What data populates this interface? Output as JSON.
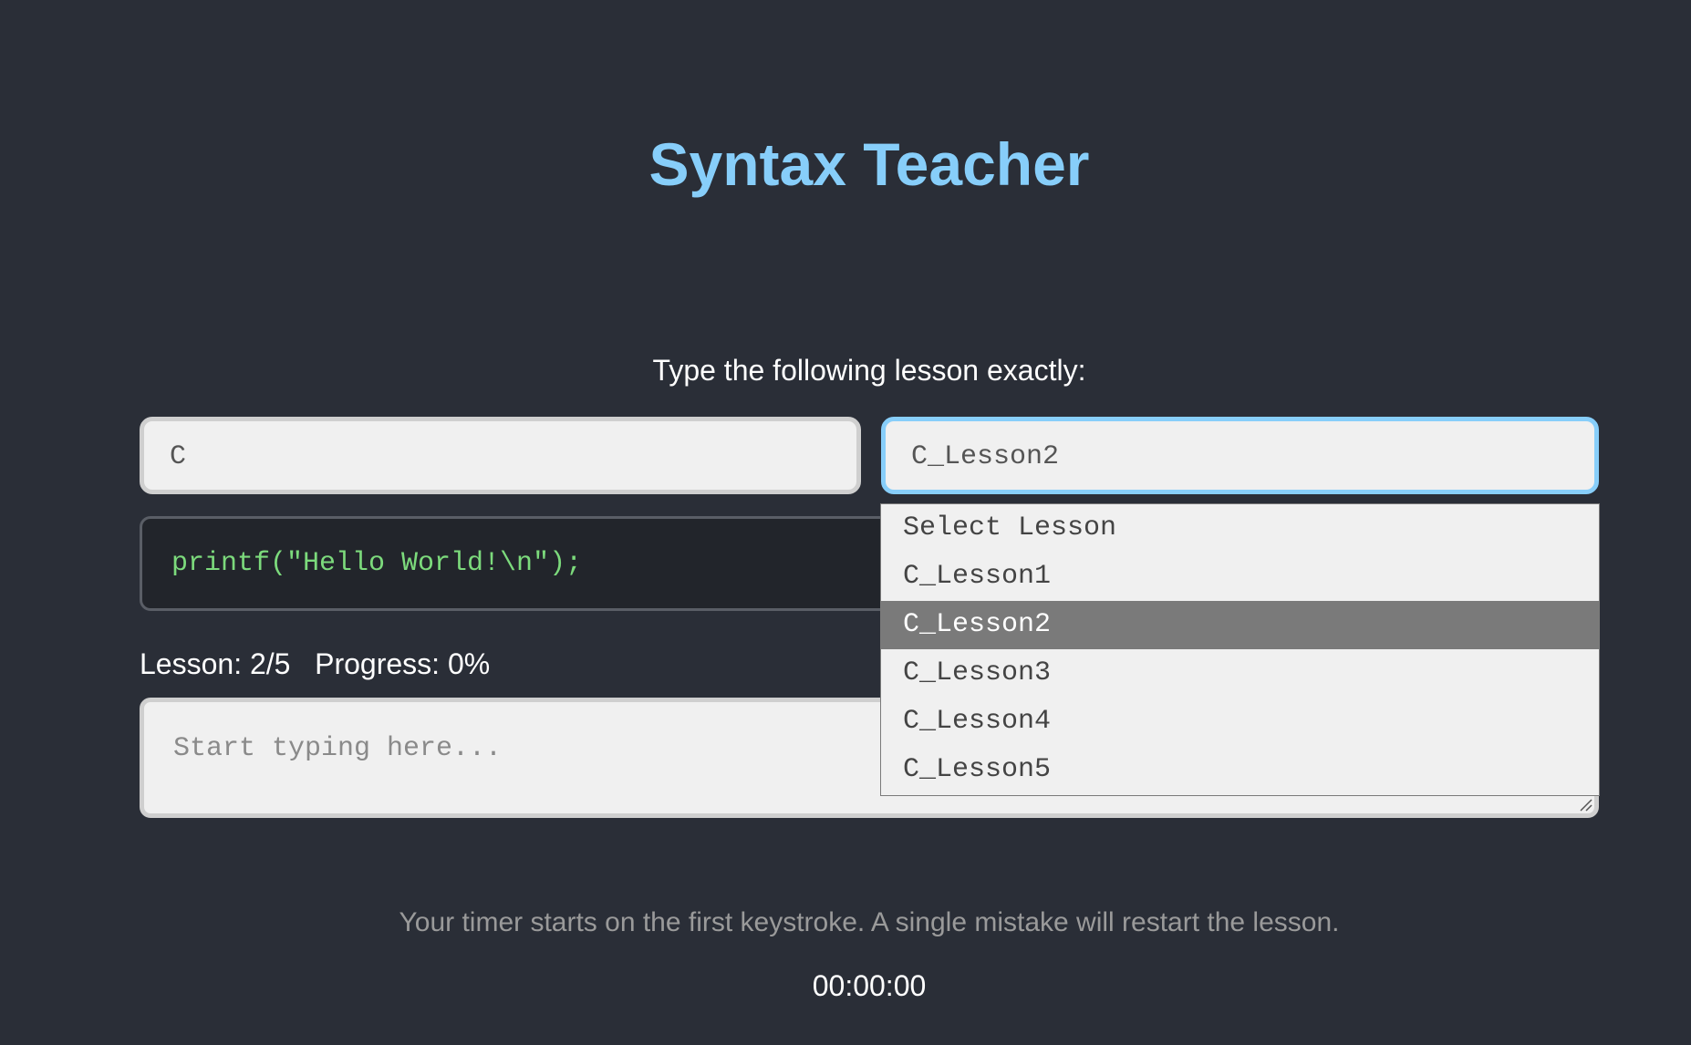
{
  "app": {
    "title": "Syntax Teacher"
  },
  "instruction": "Type the following lesson exactly:",
  "language_select": {
    "value": "C"
  },
  "lesson_select": {
    "value": "C_Lesson2",
    "options": [
      {
        "label": "Select Lesson",
        "selected": false
      },
      {
        "label": "C_Lesson1",
        "selected": false
      },
      {
        "label": "C_Lesson2",
        "selected": true
      },
      {
        "label": "C_Lesson3",
        "selected": false
      },
      {
        "label": "C_Lesson4",
        "selected": false
      },
      {
        "label": "C_Lesson5",
        "selected": false
      }
    ]
  },
  "lesson_code": "printf(\"Hello World!\\n\");",
  "status": {
    "lesson": "Lesson: 2/5",
    "progress": "Progress: 0%"
  },
  "typing_area": {
    "placeholder": "Start typing here..."
  },
  "hint": "Your timer starts on the first keystroke. A single mistake will restart the lesson.",
  "timer": "00:00:00",
  "colors": {
    "background": "#2a2e37",
    "title": "#87cefa",
    "code_text": "#7cda7c",
    "focus_border": "#87cefa",
    "option_highlight": "#7a7a7a"
  }
}
